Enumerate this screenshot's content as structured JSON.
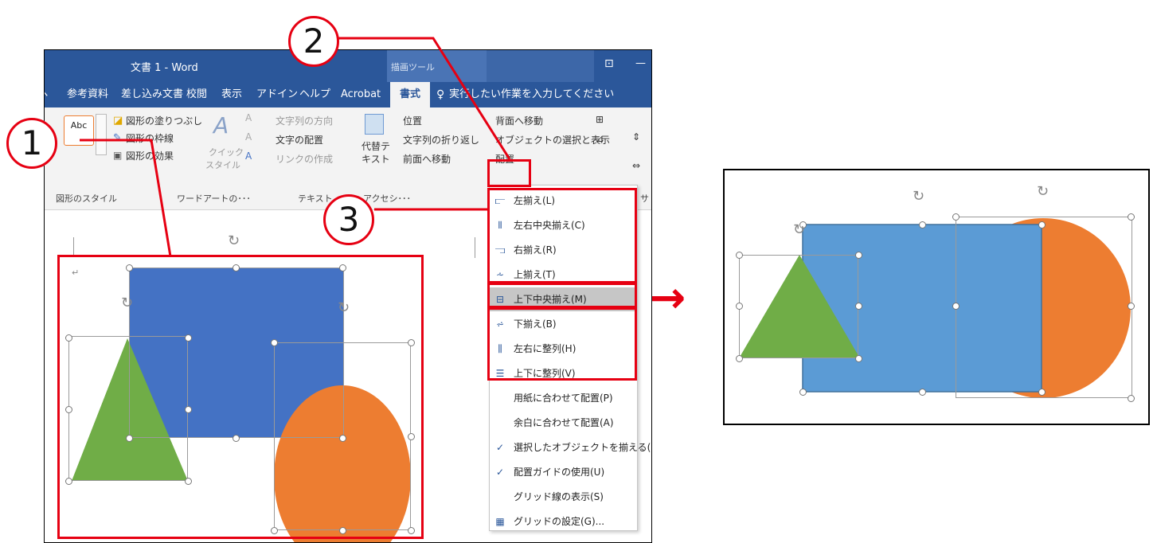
{
  "window": {
    "title": "文書 1  -  Word",
    "context_tab": "描画ツール",
    "restore_glyph": "⊡",
    "minimize_glyph": "—"
  },
  "tabs": [
    "参考資料",
    "差し込み文書",
    "校閲",
    "表示",
    "アドイン",
    "ヘルプ",
    "Acrobat"
  ],
  "active_tab": "書式",
  "tellme": "実行したい作業を入力してください",
  "ribbon": {
    "style_preview": "Abc",
    "fill": "図形の塗りつぶし",
    "outline": "図形の枠線",
    "effects": "図形の効果",
    "group_styles": "図形のスタイル",
    "quick_style": "クイック",
    "quick_style2": "スタイル",
    "text_direction": "文字列の方向",
    "text_align": "文字の配置",
    "link": "リンクの作成",
    "group_wordart": "ワードアートの･･･",
    "group_text": "テキスト",
    "group_access": "アクセシ･･･",
    "alt_text1": "代替テ",
    "alt_text2": "キスト",
    "position": "位置",
    "wrap": "文字列の折り返し",
    "forward": "前面へ移動",
    "backward": "背面へ移動",
    "selection_pane": "オブジェクトの選択と表示",
    "align": "配置",
    "size_group": "サ"
  },
  "menu": {
    "items": [
      {
        "label": "左揃え(L)",
        "icon": "align-left-icon",
        "glyph": "⫍"
      },
      {
        "label": "左右中央揃え(C)",
        "icon": "align-center-icon",
        "glyph": "⫴"
      },
      {
        "label": "右揃え(R)",
        "icon": "align-right-icon",
        "glyph": "⫎"
      },
      {
        "label": "上揃え(T)",
        "icon": "align-top-icon",
        "glyph": "⩪"
      },
      {
        "label": "上下中央揃え(M)",
        "icon": "align-middle-icon",
        "glyph": "⊟"
      },
      {
        "label": "下揃え(B)",
        "icon": "align-bottom-icon",
        "glyph": "⩫"
      },
      {
        "label": "左右に整列(H)",
        "icon": "distribute-horizontal-icon",
        "glyph": "⫼"
      },
      {
        "label": "上下に整列(V)",
        "icon": "distribute-vertical-icon",
        "glyph": "☰"
      },
      {
        "label": "用紙に合わせて配置(P)",
        "icon": "",
        "glyph": ""
      },
      {
        "label": "余白に合わせて配置(A)",
        "icon": "",
        "glyph": ""
      },
      {
        "label": "選択したオブジェクトを揃える(O)",
        "icon": "check-icon",
        "glyph": "✓"
      },
      {
        "label": "配置ガイドの使用(U)",
        "icon": "check-icon",
        "glyph": "✓"
      },
      {
        "label": "グリッド線の表示(S)",
        "icon": "",
        "glyph": ""
      },
      {
        "label": "グリッドの設定(G)...",
        "icon": "grid-icon",
        "glyph": "▦"
      }
    ],
    "selected_index": 4
  },
  "callouts": {
    "one": "1",
    "two": "2",
    "three": "3"
  },
  "arrow": "→",
  "colors": {
    "word_blue": "#2b579a",
    "highlight_red": "#e60012",
    "rect_blue": "#4472c4",
    "rect_blue_after": "#5b9bd5",
    "triangle_green": "#70ad47",
    "circle_orange": "#ed7d31"
  }
}
